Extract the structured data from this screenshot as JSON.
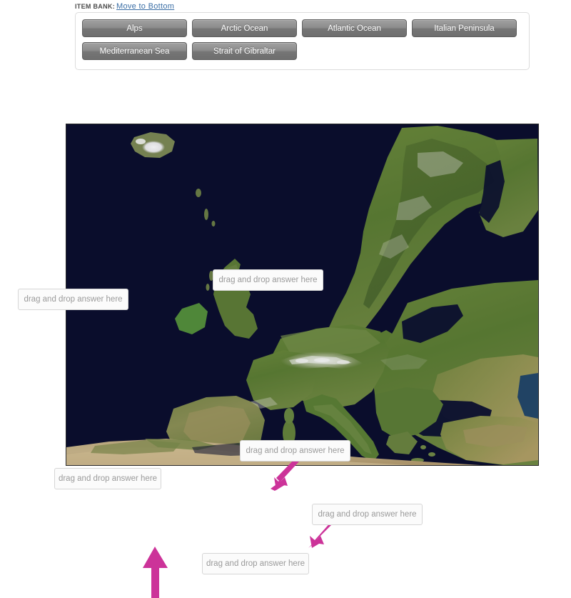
{
  "item_bank": {
    "label": "ITEM BANK:",
    "move_link": "Move to Bottom",
    "items": [
      {
        "label": "Alps"
      },
      {
        "label": "Arctic Ocean"
      },
      {
        "label": "Atlantic Ocean"
      },
      {
        "label": "Italian Peninsula"
      },
      {
        "label": "Mediterranean Sea"
      },
      {
        "label": "Strait of Gibraltar"
      }
    ]
  },
  "map": {
    "placeholder": "drag and drop answer here",
    "drop_targets": [
      {
        "id": "arctic",
        "text": "drag and drop answer here"
      },
      {
        "id": "atlantic",
        "text": "drag and drop answer here"
      },
      {
        "id": "alps",
        "text": "drag and drop answer here"
      },
      {
        "id": "italian",
        "text": "drag and drop answer here"
      },
      {
        "id": "mediterranean",
        "text": "drag and drop answer here"
      },
      {
        "id": "gibraltar",
        "text": "drag and drop answer here"
      }
    ]
  },
  "colors": {
    "arrow": "#cc3399",
    "link": "#3a6ea5",
    "ocean": "#0c1030",
    "button_top": "#a0a0a0",
    "button_bottom": "#6e6e6e",
    "placeholder_text": "#9a9a9a"
  }
}
